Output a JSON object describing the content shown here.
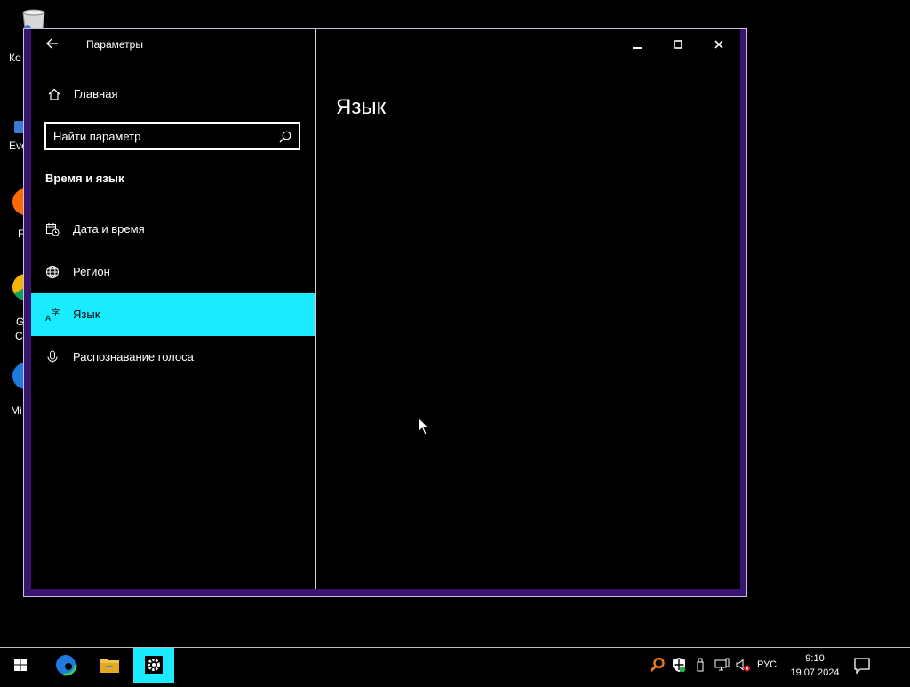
{
  "desktop": {
    "labels": [
      "Ко",
      "Eve",
      "F",
      "G",
      "C",
      "Mi"
    ]
  },
  "window": {
    "title": "Параметры",
    "home_label": "Главная",
    "search": {
      "placeholder": "Найти параметр"
    },
    "section_heading": "Время и язык",
    "nav_items": [
      {
        "label": "Дата и время",
        "icon": "calendar-clock-icon"
      },
      {
        "label": "Регион",
        "icon": "globe-icon"
      },
      {
        "label": "Язык",
        "icon": "language-icon",
        "selected": true
      },
      {
        "label": "Распознавание голоса",
        "icon": "microphone-icon"
      }
    ],
    "page_heading": "Язык",
    "accent_color": "#1aebff",
    "frame_color": "#3a1570"
  },
  "taskbar": {
    "language": "РУС",
    "time": "9:10",
    "date": "19.07.2024",
    "active_app": "settings"
  }
}
